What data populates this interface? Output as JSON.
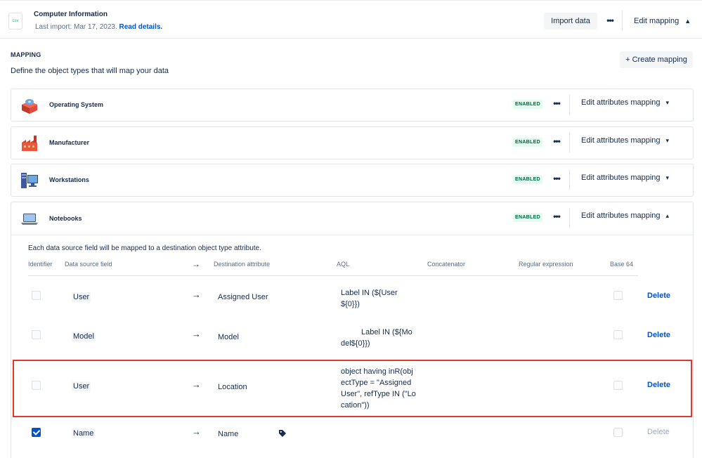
{
  "header": {
    "file_icon_label": "csv",
    "title": "Computer Information",
    "last_import": "Last import: Mar 17, 2023.",
    "read_details": "Read details.",
    "import_button": "Import data",
    "more_label": "•••",
    "edit_mapping": "Edit mapping",
    "chevron_up": "▲"
  },
  "mapping": {
    "heading": "MAPPING",
    "description": "Define the object types that will map your data",
    "create_button": "+ Create mapping"
  },
  "object_types": [
    {
      "label": "Operating System",
      "status": "ENABLED",
      "more": "•••",
      "edit": "Edit attributes mapping",
      "chevron": "▾",
      "icon": "operating-system-icon"
    },
    {
      "label": "Manufacturer",
      "status": "ENABLED",
      "more": "•••",
      "edit": "Edit attributes mapping",
      "chevron": "▾",
      "icon": "factory-icon"
    },
    {
      "label": "Workstations",
      "status": "ENABLED",
      "more": "•••",
      "edit": "Edit attributes mapping",
      "chevron": "▾",
      "icon": "workstation-icon"
    },
    {
      "label": "Notebooks",
      "status": "ENABLED",
      "more": "•••",
      "edit": "Edit attributes mapping",
      "chevron": "▴",
      "icon": "laptop-icon"
    }
  ],
  "attribute_table": {
    "description": "Each data source field will be mapped to a destination object type attribute.",
    "columns": {
      "identifier": "Identifier",
      "source": "Data source field",
      "arrow": "→",
      "destination": "Destination attribute",
      "aql": "AQL",
      "concatenator": "Concatenator",
      "regex": "Regular expression",
      "base64": "Base 64"
    },
    "rows": [
      {
        "identifier_checked": false,
        "source": "User",
        "arrow": "→",
        "destination": "Assigned User",
        "aql": [
          "Label IN (${User",
          "${0}})"
        ],
        "delete": "Delete"
      },
      {
        "identifier_checked": false,
        "source": "Model",
        "arrow": "→",
        "destination": "Model",
        "aql": [
          "Label IN (${Mo",
          "del${0}})"
        ],
        "delete": "Delete"
      },
      {
        "identifier_checked": false,
        "source": "User",
        "arrow": "→",
        "destination": "Location",
        "aql": [
          "object having inR(obj",
          "ectType = \"Assigned",
          "User\", refType IN (\"Lo",
          "cation\"))"
        ],
        "delete": "Delete"
      },
      {
        "identifier_checked": true,
        "source": "Name",
        "arrow": "→",
        "destination": "Name",
        "aql": [],
        "delete": "Delete"
      }
    ]
  },
  "colors": {
    "accent": "#0052cc",
    "enabled_bg": "#e3fcef",
    "enabled_text": "#006644",
    "highlight": "#e5382a"
  }
}
